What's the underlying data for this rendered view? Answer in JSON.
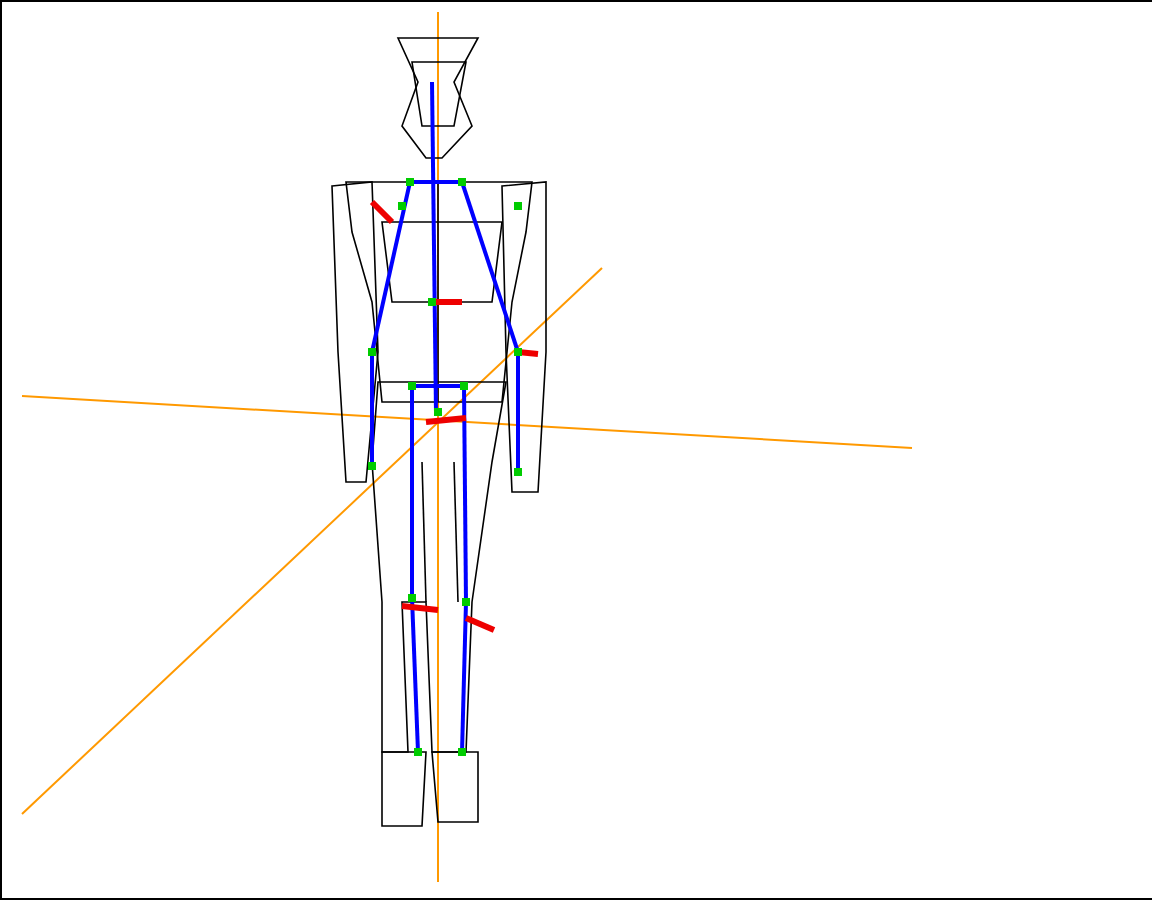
{
  "viewport": {
    "kind": "wireframe",
    "show_axes": true
  }
}
